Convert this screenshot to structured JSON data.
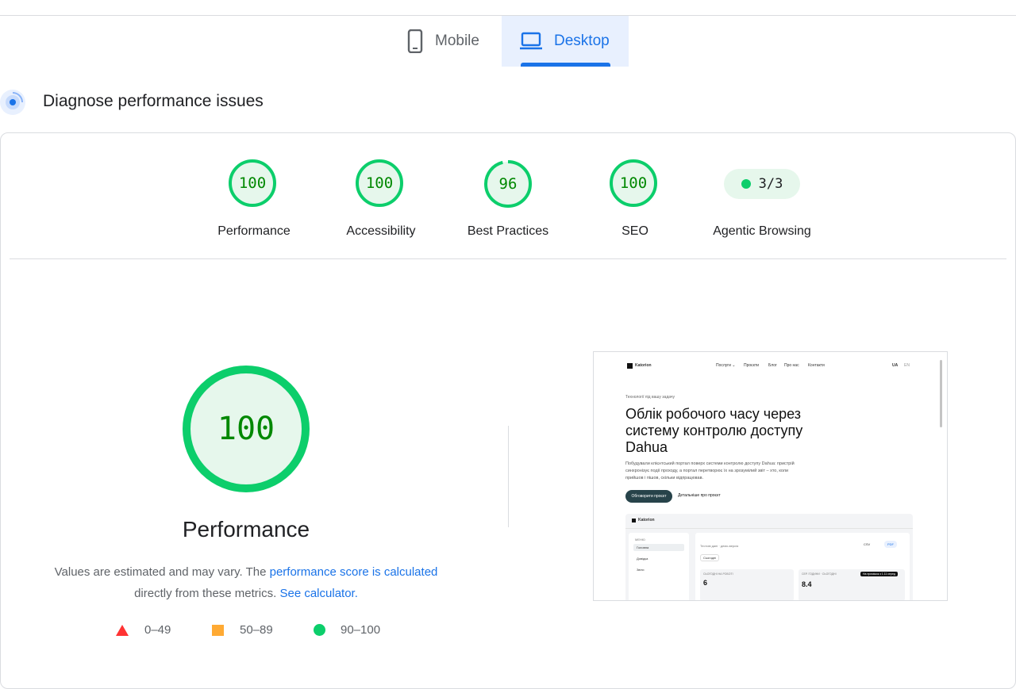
{
  "tabs": [
    {
      "label": "Mobile",
      "icon": "phone-icon",
      "selected": false
    },
    {
      "label": "Desktop",
      "icon": "laptop-icon",
      "selected": true
    }
  ],
  "section_title": "Diagnose performance issues",
  "categories": [
    {
      "label": "Performance",
      "score": "100"
    },
    {
      "label": "Accessibility",
      "score": "100"
    },
    {
      "label": "Best Practices",
      "score": "96"
    },
    {
      "label": "SEO",
      "score": "100"
    },
    {
      "label": "Agentic Browsing",
      "score": "3/3"
    }
  ],
  "performance": {
    "score": "100",
    "title": "Performance",
    "note_prefix": "Values are estimated and may vary. The",
    "note_link1": "performance score is calculated",
    "note_middle": "directly from these metrics.",
    "note_link2": "See calculator."
  },
  "legend": [
    {
      "range": "0–49",
      "shape": "triangle",
      "color": "#ff3333"
    },
    {
      "range": "50–89",
      "shape": "square",
      "color": "#ffaa33"
    },
    {
      "range": "90–100",
      "shape": "circle",
      "color": "#0cce6b"
    }
  ],
  "colors": {
    "pass": "#0cce6b",
    "pass_bg": "#e6f7ec",
    "pass_text": "#008800",
    "accent": "#1a73e8"
  },
  "screenshot": {
    "brand": "Katorion",
    "nav": [
      "Послуги ⌄",
      "Проєкти",
      "Блог",
      "Про нас",
      "Контакти"
    ],
    "lang": "UA",
    "lang_alt": "EN",
    "eyebrow": "Технології під вашу задачу",
    "hero": "Облік робочого часу через систему контролю доступу Dahua",
    "body": "Побудували клієнтський портал поверх системи контролю доступу Dahua: пристрій синхронізує події проходу, а портал перетворює їх на зрозумілий звіт – хто, коли прийшов і пішов, скільки відпрацював.",
    "cta_primary": "Обговорити проєкт",
    "cta_secondary": "Детальніше про проєкт",
    "app_brand": "Katorion",
    "menu_header": "МЕНЮ",
    "menu_items": [
      "Головна",
      "Довідка",
      "Звіти"
    ],
    "app_title": "Тестові дані · демо-версія",
    "csv": "CSV",
    "pdf": "PDF",
    "select": "Сьогодні",
    "stat1_label": "СЬОГОДНІ НА РОБОТІ",
    "stat1_value": "6",
    "stat2_label": "СЕР. ГОДИНИ · СЬОГОДНІ",
    "stat2_value": "8.4",
    "badge": "На проміжок з 1.11 серед"
  }
}
